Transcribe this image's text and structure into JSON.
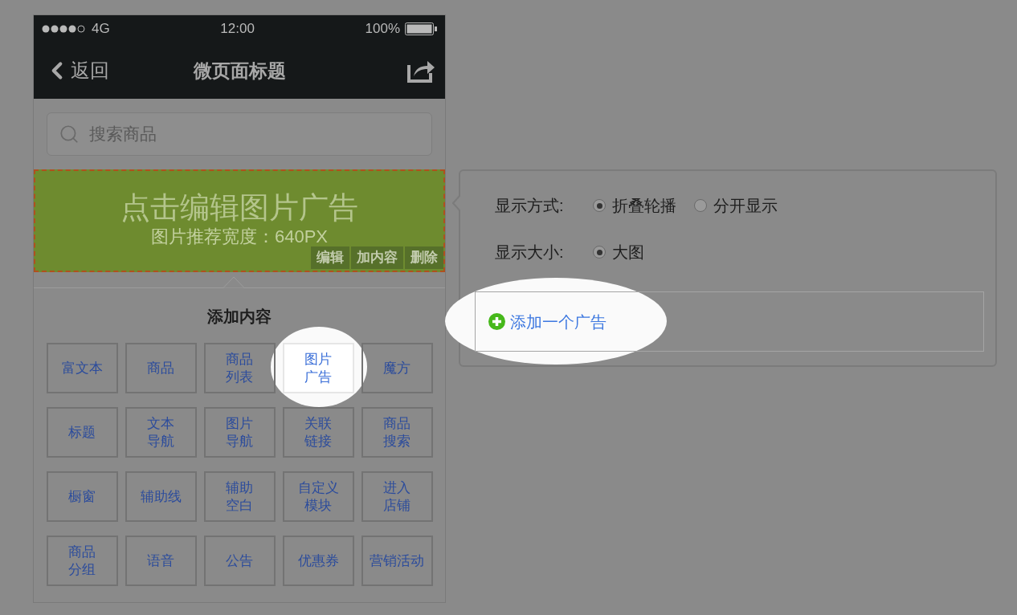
{
  "status_bar": {
    "carrier": "4G",
    "time": "12:00",
    "battery": "100%"
  },
  "nav_bar": {
    "back": "返回",
    "title": "微页面标题"
  },
  "search": {
    "placeholder": "搜索商品"
  },
  "banner": {
    "title": "点击编辑图片广告",
    "subtitle": "图片推荐宽度：640PX",
    "actions": [
      "编辑",
      "加内容",
      "删除"
    ]
  },
  "add_content": {
    "title": "添加内容",
    "items": [
      {
        "label": "富文本",
        "kind": "single",
        "spotlight": false
      },
      {
        "label": "商品",
        "kind": "single",
        "spotlight": false
      },
      {
        "label": "商品列表",
        "kind": "stacked",
        "spotlight": false
      },
      {
        "label": "图片广告",
        "kind": "stacked",
        "spotlight": true
      },
      {
        "label": "魔方",
        "kind": "single",
        "spotlight": false
      },
      {
        "label": "标题",
        "kind": "single",
        "spotlight": false
      },
      {
        "label": "文本导航",
        "kind": "stacked",
        "spotlight": false
      },
      {
        "label": "图片导航",
        "kind": "stacked",
        "spotlight": false
      },
      {
        "label": "关联链接",
        "kind": "stacked",
        "spotlight": false
      },
      {
        "label": "商品搜索",
        "kind": "stacked",
        "spotlight": false
      },
      {
        "label": "橱窗",
        "kind": "single",
        "spotlight": false
      },
      {
        "label": "辅助线",
        "kind": "single",
        "spotlight": false
      },
      {
        "label": "辅助空白",
        "kind": "stacked",
        "spotlight": false
      },
      {
        "label": "自定义模块",
        "kind": "stacked",
        "spotlight": false
      },
      {
        "label": "进入店铺",
        "kind": "stacked",
        "spotlight": false
      },
      {
        "label": "商品分组",
        "kind": "stacked",
        "spotlight": false
      },
      {
        "label": "语音",
        "kind": "single",
        "spotlight": false
      },
      {
        "label": "公告",
        "kind": "single",
        "spotlight": false
      },
      {
        "label": "优惠券",
        "kind": "single",
        "spotlight": false
      },
      {
        "label": "营销活动",
        "kind": "single",
        "spotlight": false
      }
    ]
  },
  "settings": {
    "rows": [
      {
        "label": "显示方式:",
        "options": [
          {
            "label": "折叠轮播",
            "selected": true
          },
          {
            "label": "分开显示",
            "selected": false
          }
        ]
      },
      {
        "label": "显示大小:",
        "options": [
          {
            "label": "大图",
            "selected": true
          }
        ]
      }
    ],
    "add_link": {
      "label": "添加一个广告",
      "spotlight": true
    }
  }
}
